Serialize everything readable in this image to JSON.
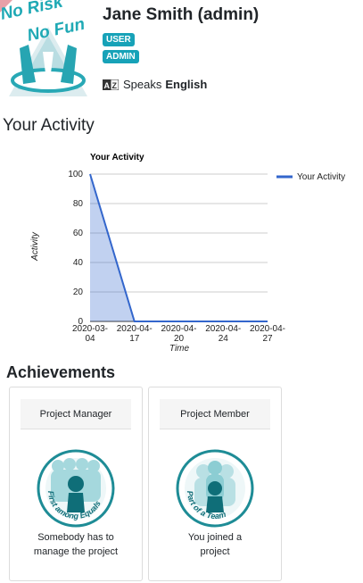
{
  "profile": {
    "logo_text": [
      "No Risk",
      "No Fun"
    ],
    "name": "Jane Smith (admin)",
    "badges": [
      "USER",
      "ADMIN"
    ],
    "speaks_label": "Speaks",
    "language": "English"
  },
  "activity_section": {
    "title": "Your Activity"
  },
  "chart_data": {
    "type": "area",
    "title": "Your Activity",
    "xlabel": "Time",
    "ylabel": "Activity",
    "categories": [
      "2020-03-04",
      "2020-04-17",
      "2020-04-20",
      "2020-04-24",
      "2020-04-27"
    ],
    "category_labels": [
      [
        "2020-03-",
        "04"
      ],
      [
        "2020-04-",
        "17"
      ],
      [
        "2020-04-",
        "20"
      ],
      [
        "2020-04-",
        "24"
      ],
      [
        "2020-04-",
        "27"
      ]
    ],
    "series": [
      {
        "name": "Your Activity",
        "values": [
          100,
          0,
          0,
          0,
          0
        ],
        "color": "#3366cc"
      }
    ],
    "ylim": [
      0,
      100
    ],
    "yticks": [
      0,
      20,
      40,
      60,
      80,
      100
    ],
    "grid": true,
    "legend": "right"
  },
  "achievements": {
    "title": "Achievements",
    "items": [
      {
        "name": "Project Manager",
        "badge_text": "First among Equals",
        "description": [
          "Somebody has to",
          "manage the project"
        ]
      },
      {
        "name": "Project Member",
        "badge_text": "Part of a Team",
        "description": [
          "You joined a",
          "project"
        ]
      }
    ]
  },
  "colors": {
    "accent": "#17a2b8",
    "teal": "#1e8c96",
    "series": "#3366cc"
  }
}
